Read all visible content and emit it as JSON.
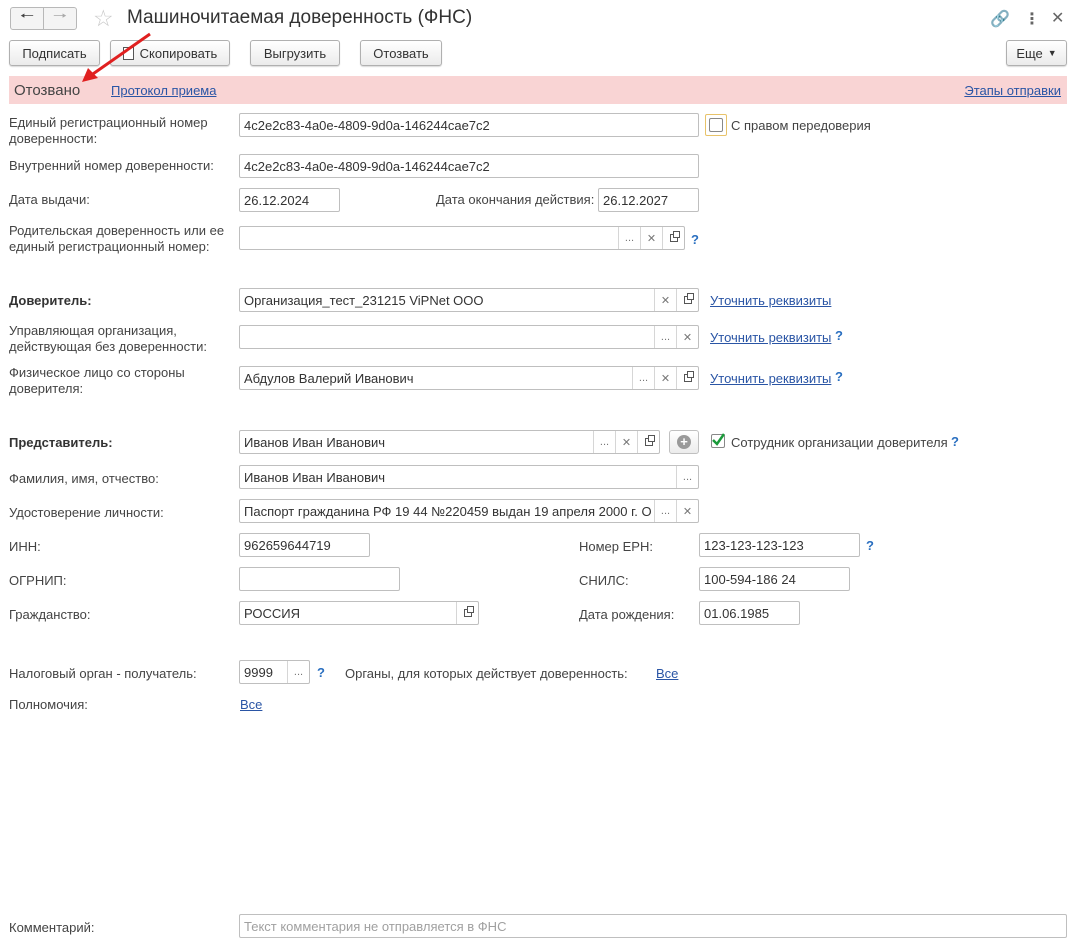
{
  "window": {
    "title": "Машиночитаемая доверенность (ФНС)"
  },
  "icons": {
    "back": "arrow-left-icon",
    "forward": "arrow-right-icon",
    "favorite": "star-icon",
    "link": "link-icon",
    "more": "more-vertical-icon",
    "close": "close-icon"
  },
  "toolbar": {
    "sign": "Подписать",
    "copy": "Скопировать",
    "export": "Выгрузить",
    "revoke": "Отозвать",
    "more": "Еще"
  },
  "status": {
    "text": "Отозвано",
    "protocol_link": "Протокол приема",
    "stages_link": "Этапы отправки",
    "bg_color": "#f9d4d4"
  },
  "form": {
    "reg_number": {
      "label_line1": "Единый регистрационный номер",
      "label_line2": "доверенности:",
      "value": "4c2e2c83-4a0e-4809-9d0a-146244cae7c2"
    },
    "redelegation": {
      "label": "С правом передоверия",
      "checked": false
    },
    "internal_number": {
      "label": "Внутренний номер доверенности:",
      "value": "4c2e2c83-4a0e-4809-9d0a-146244cae7c2"
    },
    "issue_date": {
      "label": "Дата выдачи:",
      "value": "26.12.2024"
    },
    "end_date": {
      "label": "Дата окончания действия:",
      "value": "26.12.2027"
    },
    "parent": {
      "label_line1": "Родительская доверенность или ее",
      "label_line2": "единый регистрационный номер:",
      "value": ""
    },
    "principal": {
      "label": "Доверитель:",
      "value": "Организация_тест_231215 ViPNet ООО",
      "link": "Уточнить реквизиты"
    },
    "managing_org": {
      "label_line1": "Управляющая организация,",
      "label_line2": "действующая без доверенности:",
      "value": "",
      "link": "Уточнить реквизиты"
    },
    "individual": {
      "label_line1": "Физическое лицо со стороны",
      "label_line2": "доверителя:",
      "value": "Абдулов Валерий Иванович",
      "link": "Уточнить реквизиты"
    },
    "representative": {
      "label": "Представитель:",
      "value": "Иванов Иван Иванович",
      "employee_label": "Сотрудник организации доверителя",
      "employee_checked": true
    },
    "full_name": {
      "label": "Фамилия, имя, отчество:",
      "value": "Иванов Иван Иванович"
    },
    "identity": {
      "label": "Удостоверение личности:",
      "value": "Паспорт гражданина РФ 19 44 №220459 выдан 19 апреля 2000 г. О"
    },
    "inn": {
      "label": "ИНН:",
      "value": "962659644719"
    },
    "ern": {
      "label": "Номер ЕРН:",
      "value": "123-123-123-123"
    },
    "ogrnip": {
      "label": "ОГРНИП:",
      "value": ""
    },
    "snils": {
      "label": "СНИЛС:",
      "value": "100-594-186 24"
    },
    "citizenship": {
      "label": "Гражданство:",
      "value": "РОССИЯ"
    },
    "birth_date": {
      "label": "Дата рождения:",
      "value": "01.06.1985"
    },
    "tax_authority": {
      "label": "Налоговый орган - получатель:",
      "value": "9999"
    },
    "authorities": {
      "label": "Органы, для которых действует доверенность:",
      "link": "Все"
    },
    "powers": {
      "label": "Полномочия:",
      "link": "Все"
    },
    "comment": {
      "label": "Комментарий:",
      "placeholder": "Текст комментария не отправляется в ФНС"
    },
    "help": "?"
  }
}
